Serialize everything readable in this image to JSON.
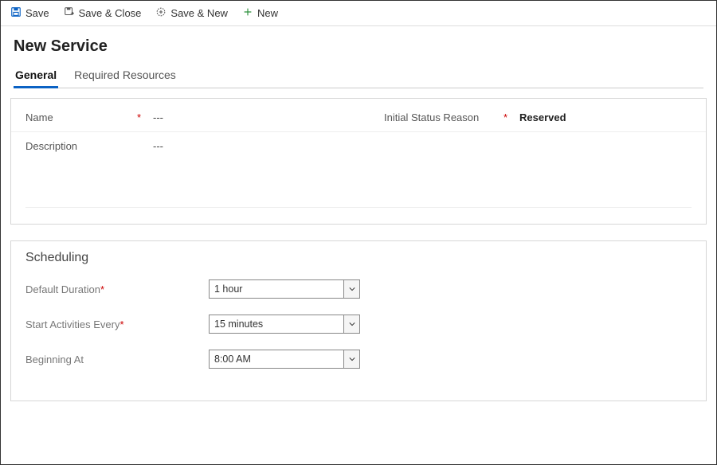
{
  "toolbar": {
    "save": "Save",
    "saveClose": "Save & Close",
    "saveNew": "Save & New",
    "new": "New"
  },
  "page": {
    "title": "New Service"
  },
  "tabs": {
    "general": "General",
    "requiredResources": "Required Resources"
  },
  "fields": {
    "name": {
      "label": "Name",
      "value": "---"
    },
    "initialStatus": {
      "label": "Initial Status Reason",
      "value": "Reserved"
    },
    "description": {
      "label": "Description",
      "value": "---"
    }
  },
  "scheduling": {
    "title": "Scheduling",
    "defaultDuration": {
      "label": "Default Duration",
      "value": "1 hour"
    },
    "startActivitiesEvery": {
      "label": "Start Activities Every",
      "value": "15 minutes"
    },
    "beginningAt": {
      "label": "Beginning At",
      "value": "8:00 AM"
    }
  },
  "glyphs": {
    "required": "*"
  }
}
